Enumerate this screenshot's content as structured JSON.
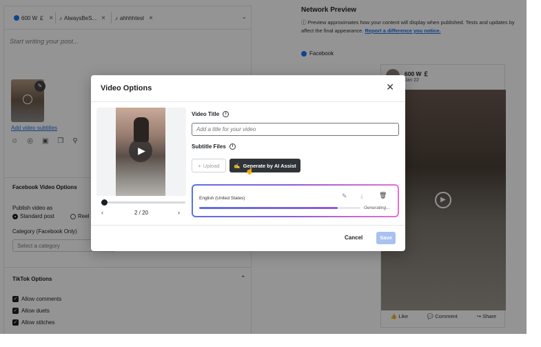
{
  "composer": {
    "profiles": [
      {
        "label": "600 W ￡",
        "network": "facebook"
      },
      {
        "label": "AlwaysBeS...",
        "network": "tiktok"
      },
      {
        "label": "ahhhhtest",
        "network": "tiktok"
      }
    ],
    "post_placeholder": "Start writing your post...",
    "add_subtitles_link": "Add video subtitles",
    "facebook_options": {
      "title": "Facebook Video Options",
      "publish_as_label": "Publish video as",
      "publish_options": [
        "Standard post",
        "Reel"
      ],
      "selected_publish": "Standard post",
      "category_label": "Category (Facebook Only)",
      "category_placeholder": "Select a category"
    },
    "tiktok_options": {
      "title": "TikTok Options",
      "checkboxes": [
        "Allow comments",
        "Allow duets",
        "Allow stitches"
      ]
    }
  },
  "network_preview": {
    "title": "Network Preview",
    "description": "Preview approximates how your content will display when published. Tests and updates by",
    "description_cont": "affect the final appearance.",
    "report_link": "Report a difference you notice.",
    "network_label": "Facebook",
    "card": {
      "name": "600 W ￡",
      "date": "Jan 22",
      "actions": [
        "Like",
        "Comment",
        "Share"
      ]
    }
  },
  "modal": {
    "title": "Video Options",
    "video_title_label": "Video Title",
    "video_title_placeholder": "Add a title for your video",
    "subtitle_files_label": "Subtitle Files",
    "upload_label": "Upload",
    "ai_assist_label": "Generate by AI Assist",
    "pager": "2 / 20",
    "subtitle_file": {
      "language": "English (United States)",
      "status": "Generating...",
      "progress": 0.86
    },
    "cancel_label": "Cancel",
    "save_label": "Save"
  }
}
